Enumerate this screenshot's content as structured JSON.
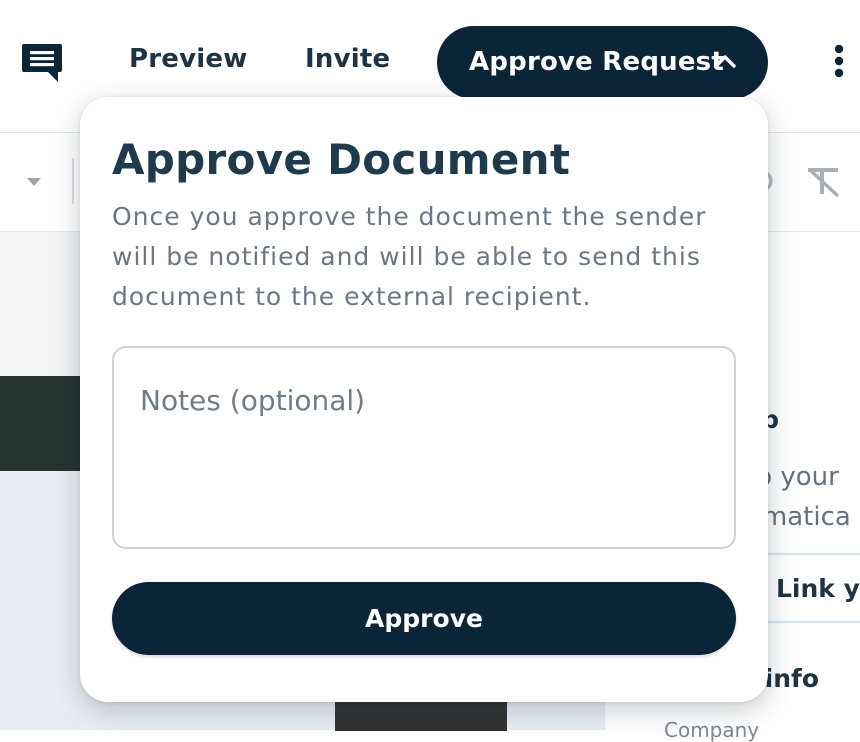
{
  "header": {
    "chat_icon": "chat-bubble-icon",
    "preview_label": "Preview",
    "invite_label": "Invite",
    "approve_request_label": "Approve Request",
    "approve_request_icon": "chevron-up-icon",
    "more_icon": "kebab-menu-icon"
  },
  "toolbar": {
    "dropdown_icon": "caret-down-icon",
    "redo_icon": "redo-icon",
    "clear_format_icon": "clear-format-icon"
  },
  "side_panel": {
    "heading": "op",
    "text_line_1": "to your",
    "text_line_2": "omatica",
    "link_button_label": "Link yo",
    "heading_2": "t info",
    "sub_label": "Company"
  },
  "popover": {
    "title": "Approve Document",
    "description": "Once you approve the document the sender will be notified and will be able to send this document to the external recipient.",
    "notes_value": "",
    "notes_placeholder": "Notes (optional)",
    "approve_label": "Approve"
  },
  "colors": {
    "primary_dark": "#0b2538",
    "title_text": "#1e3a4d",
    "muted_text": "#6b7884"
  }
}
